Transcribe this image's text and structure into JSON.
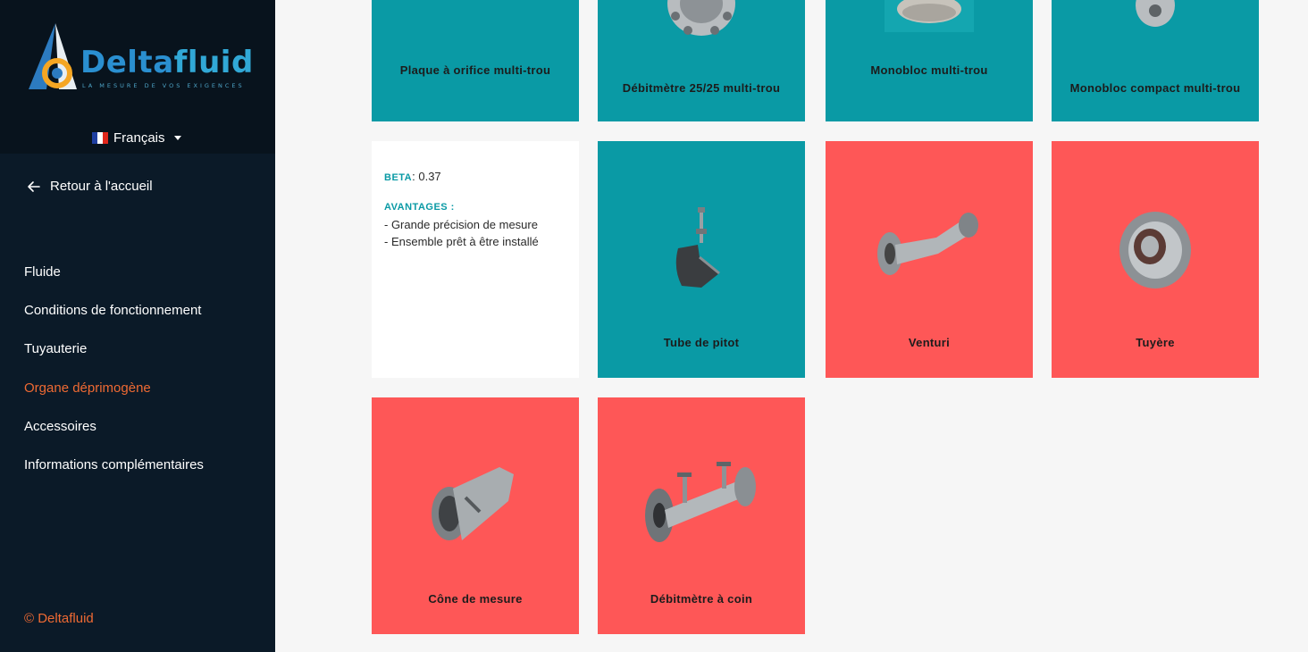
{
  "brand": {
    "name_part1": "Delta",
    "name_part2": "fluid",
    "tagline": "LA MESURE DE VOS EXIGENCES"
  },
  "language": {
    "label": "Français",
    "flag_colors": [
      "#1f3fa1",
      "#ffffff",
      "#e1271c"
    ]
  },
  "back_link": {
    "label": "Retour à l'accueil"
  },
  "nav": {
    "items": [
      {
        "label": "Fluide"
      },
      {
        "label": "Conditions de fonctionnement"
      },
      {
        "label": "Tuyauterie"
      },
      {
        "label": "Organe déprimogène",
        "active": true
      },
      {
        "label": "Accessoires"
      },
      {
        "label": "Informations complémentaires"
      }
    ]
  },
  "footer": {
    "copyright": "© Deltafluid"
  },
  "info_card": {
    "beta_key": "BETA",
    "beta_value": ": 0.37",
    "advantages_key": "AVANTAGES :",
    "advantages": [
      "- Grande précision de mesure",
      "- Ensemble prêt à être installé"
    ]
  },
  "products": [
    {
      "label": "Plaque à orifice multi-trou",
      "color": "teal",
      "icon": "orifice-plate-image"
    },
    {
      "label": "Débitmètre 25/25 multi-trou",
      "color": "teal",
      "icon": "flowmeter-flange-image"
    },
    {
      "label": "Monobloc multi-trou",
      "color": "teal",
      "icon": "monobloc-image"
    },
    {
      "label": "Monobloc compact multi-trou",
      "color": "teal",
      "icon": "compact-monobloc-image"
    },
    {
      "label": "Tube de pitot",
      "color": "teal",
      "icon": "pitot-tube-image"
    },
    {
      "label": "Venturi",
      "color": "red",
      "icon": "venturi-image"
    },
    {
      "label": "Tuyère",
      "color": "red",
      "icon": "nozzle-image"
    },
    {
      "label": "Cône de mesure",
      "color": "red",
      "icon": "measuring-cone-image"
    },
    {
      "label": "Débitmètre à coin",
      "color": "red",
      "icon": "wedge-flowmeter-image"
    }
  ],
  "colors": {
    "teal": "#0a9aa5",
    "red": "#fe5757",
    "accent": "#ef6a33",
    "sidebar": "#0b1a28"
  }
}
